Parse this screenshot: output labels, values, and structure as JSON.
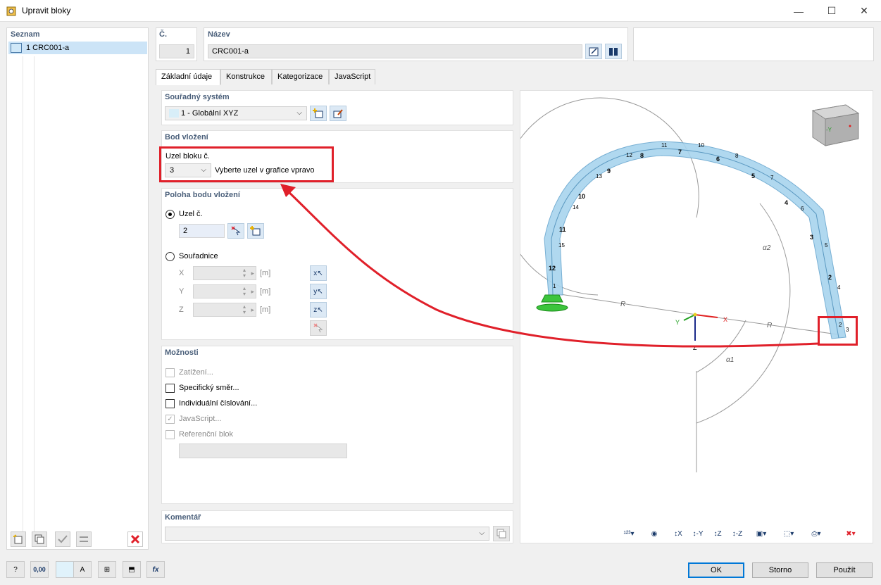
{
  "window": {
    "title": "Upravit bloky",
    "minimize": "—",
    "maximize": "☐",
    "close": "✕"
  },
  "list": {
    "header": "Seznam",
    "items": [
      {
        "label": "1  CRC001-a"
      }
    ]
  },
  "number": {
    "label": "Č.",
    "value": "1"
  },
  "name": {
    "label": "Název",
    "value": "CRC001-a"
  },
  "tabs": [
    "Základní údaje",
    "Konstrukce",
    "Kategorizace",
    "JavaScript"
  ],
  "coord_system": {
    "header": "Souřadný systém",
    "value": "1 - Globální XYZ"
  },
  "insert_point": {
    "header": "Bod vložení",
    "node_label": "Uzel bloku č.",
    "node_value": "3",
    "hint": "Vyberte uzel v grafice vpravo"
  },
  "insert_position": {
    "header": "Poloha bodu vložení",
    "node_option": "Uzel č.",
    "node_value": "2",
    "coords_option": "Souřadnice",
    "x_label": "X",
    "y_label": "Y",
    "z_label": "Z",
    "unit": "[m]"
  },
  "options": {
    "header": "Možnosti",
    "items": [
      {
        "label": "Zatížení...",
        "checked": false,
        "disabled": true
      },
      {
        "label": "Specifický směr...",
        "checked": false,
        "disabled": false
      },
      {
        "label": "Individuální číslování...",
        "checked": false,
        "disabled": false
      },
      {
        "label": "JavaScript...",
        "checked": true,
        "disabled": true
      },
      {
        "label": "Referenční blok",
        "checked": false,
        "disabled": true
      }
    ]
  },
  "comment": {
    "header": "Komentář"
  },
  "buttons": {
    "ok": "OK",
    "cancel": "Storno",
    "apply": "Použít"
  },
  "graphic": {
    "members": [
      "12",
      "11",
      "10",
      "9",
      "8",
      "7",
      "6",
      "5",
      "4",
      "3",
      "2"
    ],
    "nodes": [
      "1",
      "2",
      "3",
      "4",
      "5",
      "6",
      "7",
      "8",
      "10",
      "11",
      "12",
      "13",
      "14",
      "15"
    ],
    "dims": {
      "r": "R",
      "a1": "α1",
      "a2": "α2"
    },
    "axes": {
      "x": "X",
      "y": "Y",
      "z": "Z"
    },
    "colors": {
      "arc": "#a8d4ee",
      "support": "#3cc43c",
      "highlight": "#e0202a",
      "x_axis": "#e02020",
      "y_axis": "#20a020",
      "z_axis": "#1a2a8a"
    }
  },
  "status_icons": [
    "help-icon",
    "units-icon",
    "color-icon",
    "text-icon",
    "view-icon",
    "save-icon",
    "function-icon"
  ],
  "units_label": "0,00"
}
